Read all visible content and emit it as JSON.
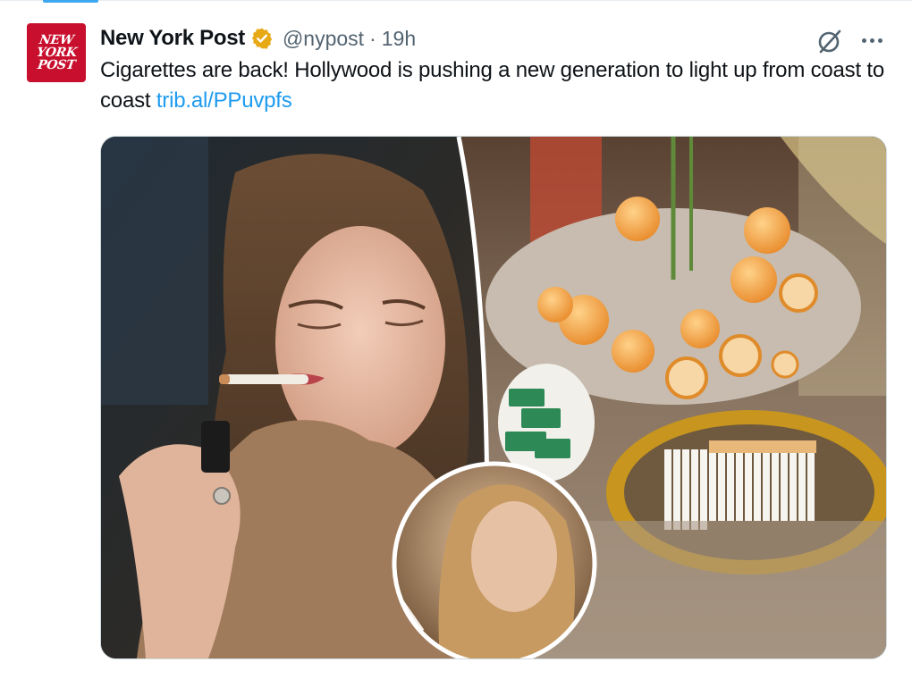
{
  "account": {
    "display_name": "New York Post",
    "handle": "@nypost",
    "separator": "·",
    "time": "19h",
    "avatar_lines": [
      "NEW",
      "YORK",
      "POST"
    ],
    "verified_color": "#e8a917"
  },
  "tweet": {
    "text": "Cigarettes are back! Hollywood is pushing a new generation to light up from coast to coast ",
    "link_text": "trib.al/PPuvpfs"
  },
  "colors": {
    "accent": "#1d9bf0",
    "avatar_bg": "#c8102e",
    "text": "#0f1419",
    "muted": "#536471"
  },
  "icons": {
    "grok": "grok-icon",
    "more": "more-options-icon",
    "verified": "verified-badge-icon"
  }
}
